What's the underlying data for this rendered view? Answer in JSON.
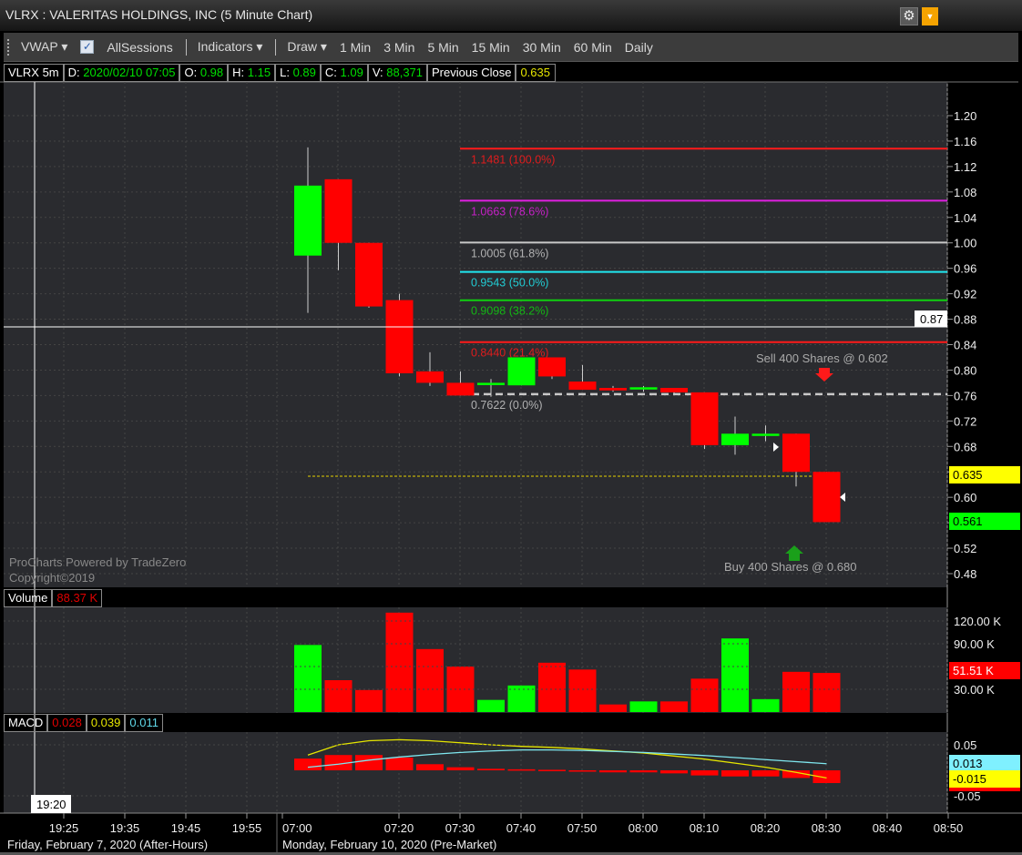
{
  "window": {
    "title": "VLRX : VALERITAS HOLDINGS, INC (5 Minute Chart)",
    "settings_icon": "gear-icon",
    "menu_icon": "dropdown-icon"
  },
  "toolbar": {
    "vwap": "VWAP ▾",
    "all_sessions": "AllSessions",
    "indicators": "Indicators ▾",
    "draw": "Draw ▾",
    "intervals": [
      "1 Min",
      "3 Min",
      "5 Min",
      "15 Min",
      "30 Min",
      "60 Min",
      "Daily"
    ],
    "all_sessions_checked": true
  },
  "info": {
    "symbol": "VLRX 5m",
    "date_label": "D:",
    "date": "2020/02/10 07:05",
    "o_label": "O:",
    "o": "0.98",
    "h_label": "H:",
    "h": "1.15",
    "l_label": "L:",
    "l": "0.89",
    "c_label": "C:",
    "c": "1.09",
    "v_label": "V:",
    "v": "88,371",
    "prev_close_label": "Previous Close",
    "prev_close": "0.635"
  },
  "colors": {
    "up": "#00ff00",
    "down": "#ff0000",
    "bg": "#2a2b2f"
  },
  "price_axis": {
    "ticks": [
      "1.20",
      "1.16",
      "1.12",
      "1.08",
      "1.04",
      "1.00",
      "0.96",
      "0.92",
      "0.88",
      "0.84",
      "0.80",
      "0.76",
      "0.72",
      "0.68",
      "0.64",
      "0.60",
      "0.56",
      "0.52",
      "0.48"
    ],
    "crosshair_label": "0.87",
    "prev_close_label": "0.635",
    "last_label": "0.561"
  },
  "fib": [
    {
      "price": 1.1481,
      "label": "1.1481 (100.0%)",
      "color": "#ff1a1a"
    },
    {
      "price": 1.0663,
      "label": "1.0663 (78.6%)",
      "color": "#e020e0"
    },
    {
      "price": 1.0005,
      "label": "1.0005 (61.8%)",
      "color": "#c8c8c8"
    },
    {
      "price": 0.9543,
      "label": "0.9543 (50.0%)",
      "color": "#20e8f0"
    },
    {
      "price": 0.9098,
      "label": "0.9098 (38.2%)",
      "color": "#10d010"
    },
    {
      "price": 0.844,
      "label": "0.8440 (21.4%)",
      "color": "#ff1a1a"
    },
    {
      "price": 0.7622,
      "label": "0.7622 (0.0%)",
      "color": "#c8c8c8",
      "dashed": true
    }
  ],
  "trades": {
    "sell": "Sell 400 Shares @ 0.602",
    "buy": "Buy 400 Shares @ 0.680"
  },
  "watermark": [
    "ProCharts Powered by TradeZero",
    "Copyright©2019"
  ],
  "chart_data": {
    "type": "candlestick",
    "candles": [
      {
        "t": "07:05",
        "o": 0.98,
        "h": 1.15,
        "l": 0.89,
        "c": 1.09,
        "v": 88.37
      },
      {
        "t": "07:10",
        "o": 1.1,
        "h": 1.1,
        "l": 0.957,
        "c": 1.0,
        "v": 42
      },
      {
        "t": "07:15",
        "o": 1.0,
        "h": 1.0,
        "l": 0.898,
        "c": 0.9,
        "v": 29
      },
      {
        "t": "07:20",
        "o": 0.91,
        "h": 0.92,
        "l": 0.79,
        "c": 0.795,
        "v": 131
      },
      {
        "t": "07:25",
        "o": 0.798,
        "h": 0.828,
        "l": 0.775,
        "c": 0.78,
        "v": 83
      },
      {
        "t": "07:30",
        "o": 0.78,
        "h": 0.798,
        "l": 0.76,
        "c": 0.76,
        "v": 60
      },
      {
        "t": "07:35",
        "o": 0.778,
        "h": 0.786,
        "l": 0.758,
        "c": 0.78,
        "v": 16
      },
      {
        "t": "07:40",
        "o": 0.776,
        "h": 0.82,
        "l": 0.776,
        "c": 0.82,
        "v": 35
      },
      {
        "t": "07:45",
        "o": 0.82,
        "h": 0.82,
        "l": 0.786,
        "c": 0.79,
        "v": 65
      },
      {
        "t": "07:50",
        "o": 0.782,
        "h": 0.808,
        "l": 0.769,
        "c": 0.769,
        "v": 56
      },
      {
        "t": "07:55",
        "o": 0.772,
        "h": 0.775,
        "l": 0.766,
        "c": 0.768,
        "v": 10
      },
      {
        "t": "08:00",
        "o": 0.771,
        "h": 0.775,
        "l": 0.766,
        "c": 0.773,
        "v": 14
      },
      {
        "t": "08:05",
        "o": 0.772,
        "h": 0.772,
        "l": 0.763,
        "c": 0.765,
        "v": 14
      },
      {
        "t": "08:10",
        "o": 0.765,
        "h": 0.765,
        "l": 0.676,
        "c": 0.682,
        "v": 44
      },
      {
        "t": "08:15",
        "o": 0.682,
        "h": 0.727,
        "l": 0.667,
        "c": 0.7,
        "v": 97
      },
      {
        "t": "08:20",
        "o": 0.698,
        "h": 0.713,
        "l": 0.688,
        "c": 0.7,
        "v": 17
      },
      {
        "t": "08:25",
        "o": 0.7,
        "h": 0.7,
        "l": 0.617,
        "c": 0.64,
        "v": 53
      },
      {
        "t": "08:30",
        "o": 0.64,
        "h": 0.64,
        "l": 0.561,
        "c": 0.561,
        "v": 51.51
      }
    ],
    "macd": {
      "hist": [
        0.023,
        0.03,
        0.03,
        0.025,
        0.012,
        0.006,
        0.003,
        0.002,
        0.001,
        -0.002,
        -0.004,
        -0.004,
        -0.006,
        -0.01,
        -0.012,
        -0.012,
        -0.015,
        -0.025
      ],
      "signal": [
        0.03,
        0.05,
        0.058,
        0.06,
        0.058,
        0.054,
        0.05,
        0.047,
        0.045,
        0.042,
        0.038,
        0.034,
        0.028,
        0.022,
        0.014,
        0.006,
        -0.004,
        -0.015
      ],
      "macd": [
        0.006,
        0.012,
        0.02,
        0.026,
        0.031,
        0.035,
        0.038,
        0.04,
        0.04,
        0.039,
        0.037,
        0.035,
        0.032,
        0.029,
        0.025,
        0.021,
        0.017,
        0.013
      ]
    },
    "price_range": [
      0.46,
      1.22
    ],
    "volume_axis": [
      "120.00 K",
      "90.00 K",
      "30.00 K"
    ],
    "macd_axis": [
      "0.05",
      "-0.05"
    ]
  },
  "volume": {
    "label": "Volume",
    "value": "88.37 K",
    "last_label": "51.51 K"
  },
  "macd": {
    "label": "MACD",
    "v1": "0.028",
    "v2": "0.039",
    "v3": "0.011",
    "axis_cyan": "0.013",
    "axis_yellow": "-0.015"
  },
  "time_axis": {
    "friday": [
      "19:25",
      "19:35",
      "19:45",
      "19:55"
    ],
    "monday": [
      "07:00",
      "07:20",
      "07:30",
      "07:40",
      "07:50",
      "08:00",
      "08:10",
      "08:20",
      "08:30",
      "08:40",
      "08:50"
    ],
    "crosshair": "19:20",
    "friday_label": "Friday, February 7, 2020 (After-Hours)",
    "monday_label": "Monday, February 10, 2020 (Pre-Market)"
  }
}
